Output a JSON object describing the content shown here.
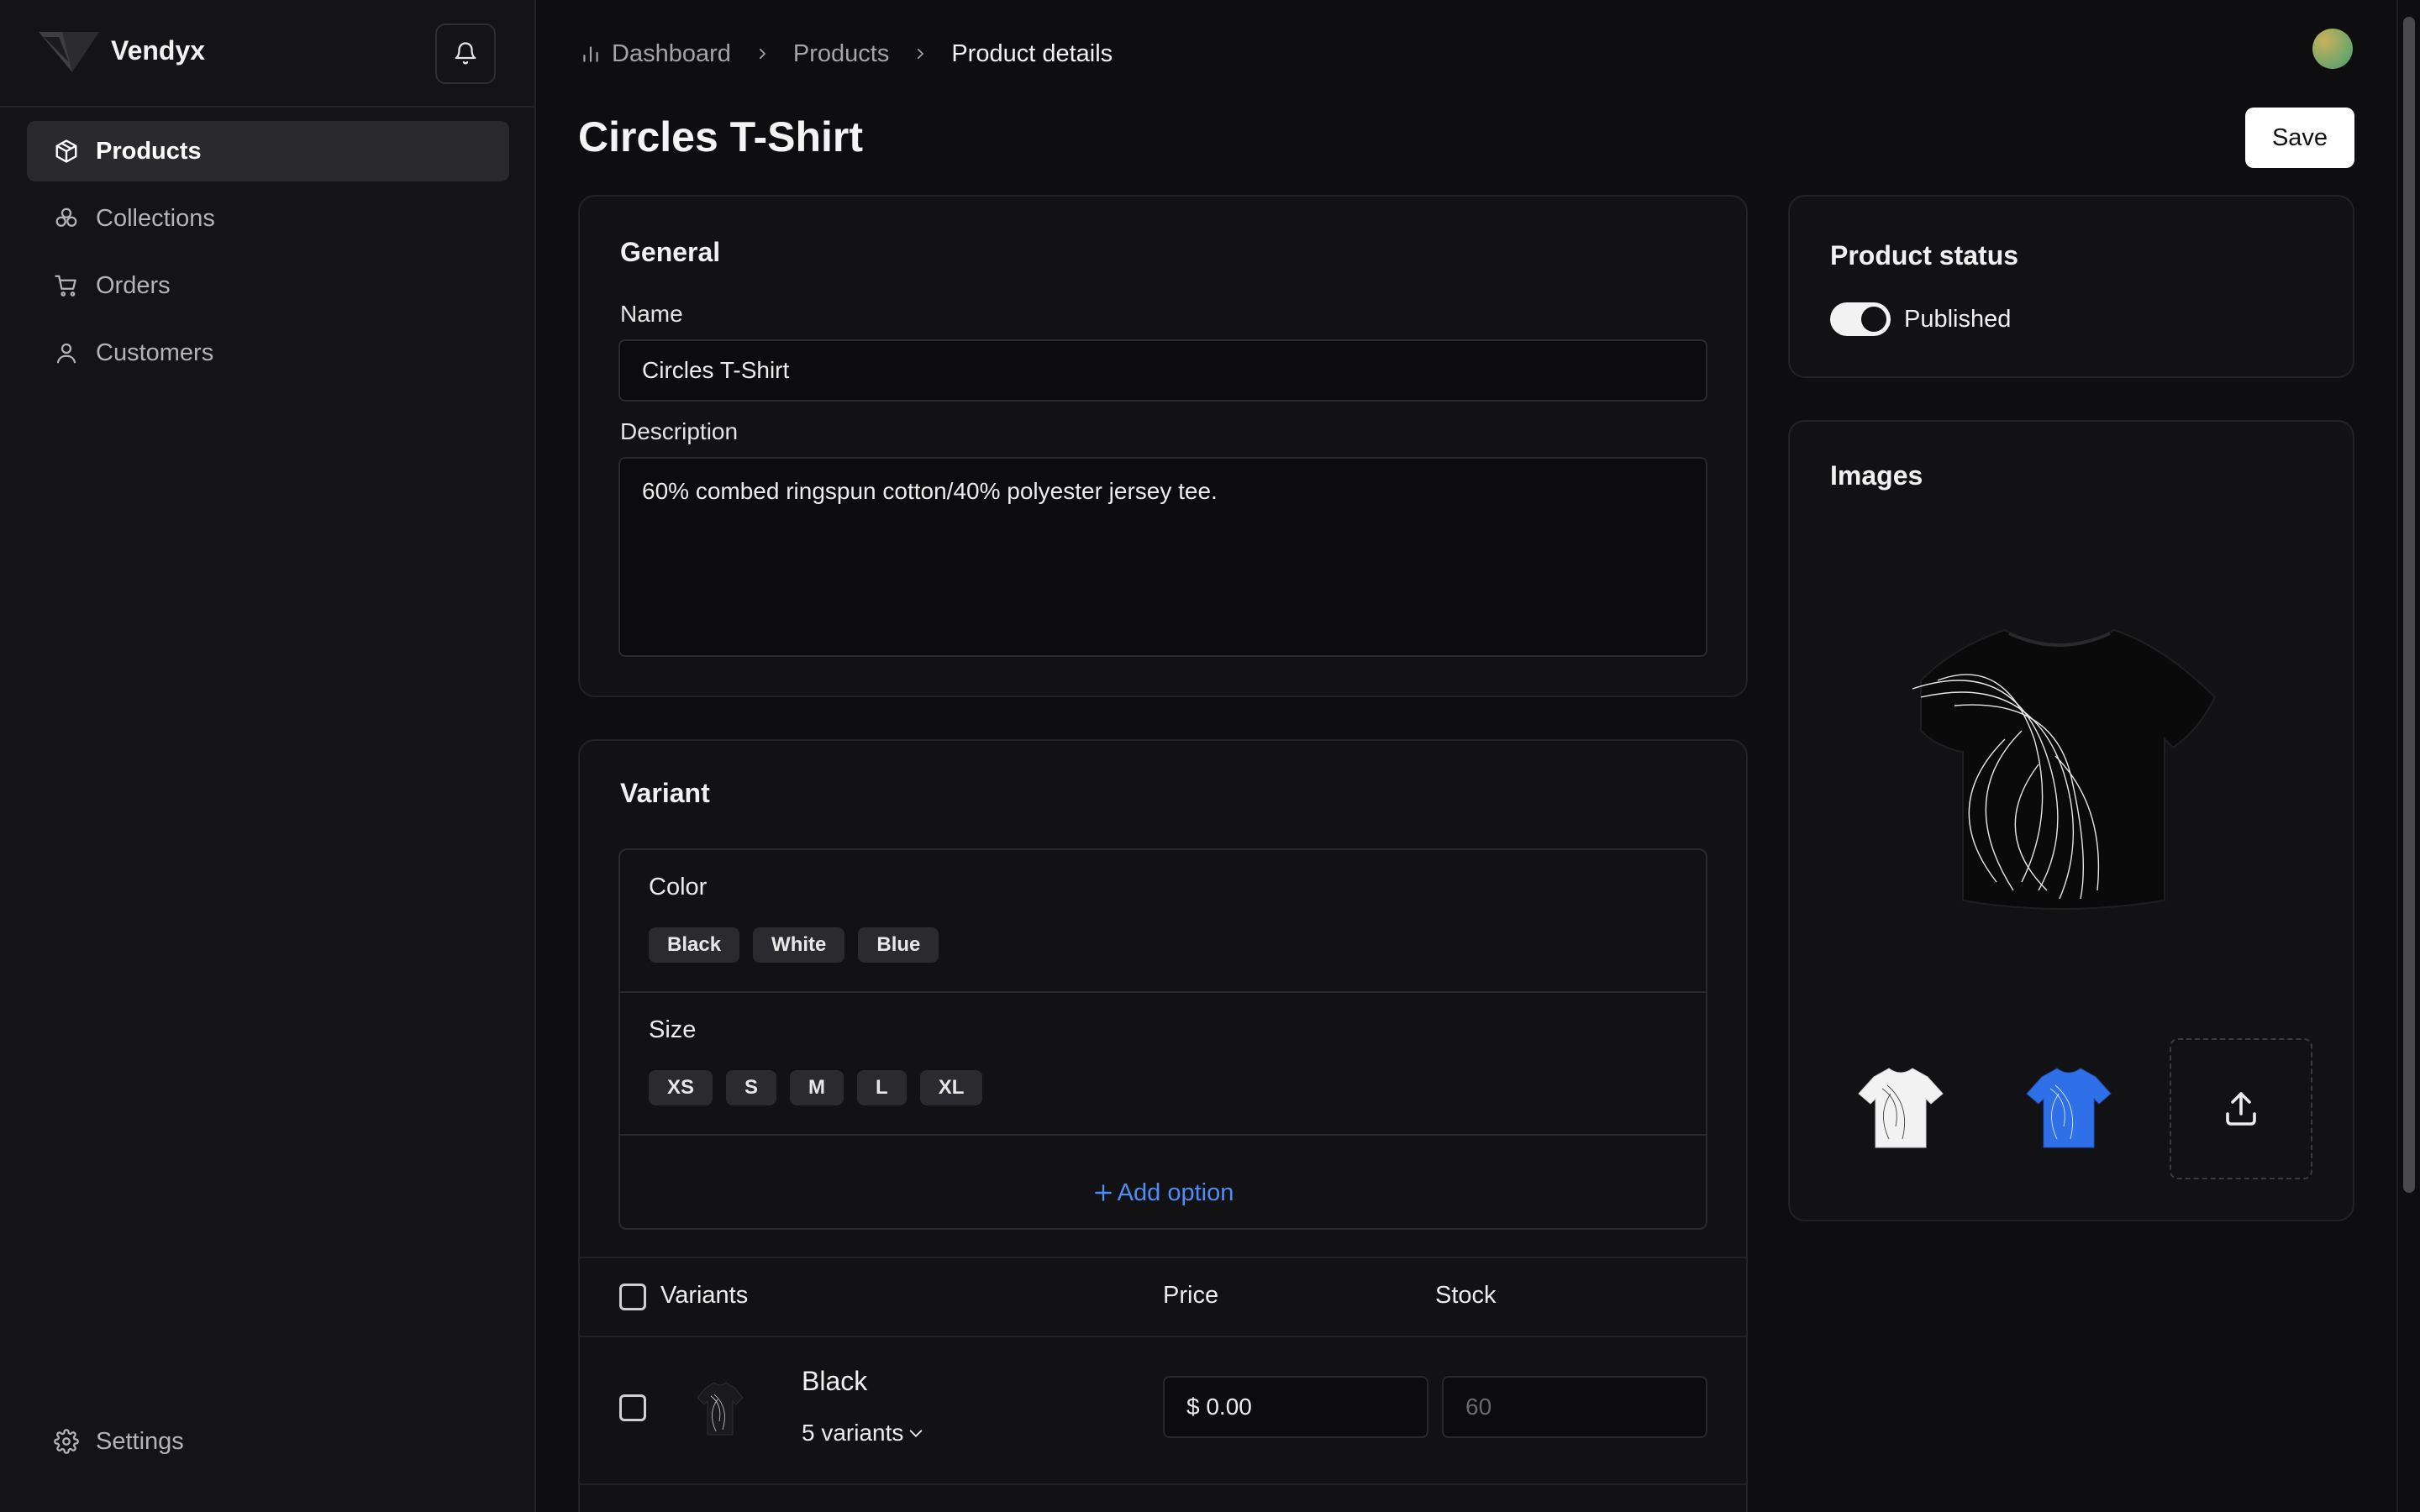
{
  "sidebar": {
    "brand": "Vendyx",
    "nav": [
      {
        "label": "Products",
        "icon": "package-icon",
        "active": true
      },
      {
        "label": "Collections",
        "icon": "collections-icon",
        "active": false
      },
      {
        "label": "Orders",
        "icon": "cart-icon",
        "active": false
      },
      {
        "label": "Customers",
        "icon": "user-icon",
        "active": false
      }
    ],
    "settings_label": "Settings"
  },
  "breadcrumb": {
    "items": [
      "Dashboard",
      "Products",
      "Product details"
    ]
  },
  "page": {
    "title": "Circles T-Shirt",
    "save_label": "Save"
  },
  "general": {
    "title": "General",
    "name_label": "Name",
    "name_value": "Circles T-Shirt",
    "description_label": "Description",
    "description_value": "60% combed ringspun cotton/40% polyester jersey tee."
  },
  "variant": {
    "title": "Variant",
    "options": [
      {
        "name": "Color",
        "values": [
          "Black",
          "White",
          "Blue"
        ]
      },
      {
        "name": "Size",
        "values": [
          "XS",
          "S",
          "M",
          "L",
          "XL"
        ]
      }
    ],
    "add_option_label": "Add option",
    "table": {
      "headers": [
        "Variants",
        "Price",
        "Stock"
      ],
      "rows": [
        {
          "name": "Black",
          "sub": "5 variants",
          "price": "$ 0.00",
          "stock_placeholder": "60"
        }
      ]
    }
  },
  "status": {
    "title": "Product status",
    "label": "Published",
    "enabled": true
  },
  "images": {
    "title": "Images"
  },
  "colors": {
    "accent": "#4f8cf5",
    "background": "#0e0e10",
    "card": "#121214",
    "blue_shirt": "#2f6fe8"
  }
}
